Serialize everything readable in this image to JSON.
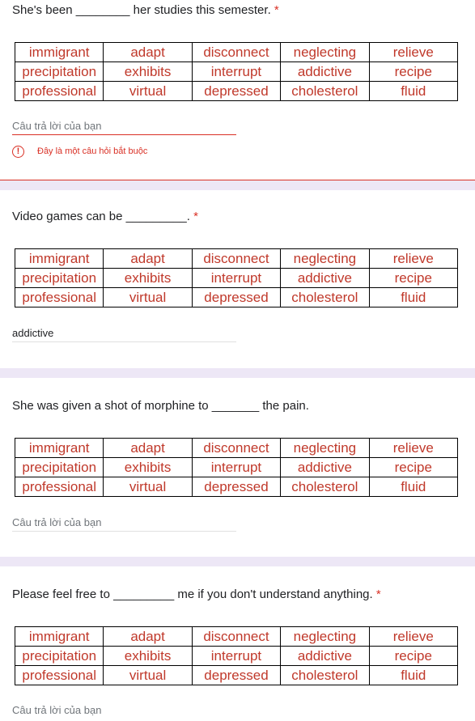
{
  "required_mark": "*",
  "word_table": [
    [
      "immigrant",
      "adapt",
      "disconnect",
      "neglecting",
      "relieve"
    ],
    [
      "precipitation",
      "exhibits",
      "interrupt",
      "addictive",
      "recipe"
    ],
    [
      "professional",
      "virtual",
      "depressed",
      "cholesterol",
      "fluid"
    ]
  ],
  "questions": [
    {
      "text": "She's been ________ her studies this semester.",
      "required": true,
      "answer_placeholder": "Câu trả lời của bạn",
      "answer_value": "",
      "error": "Đây là một câu hỏi bắt buộc"
    },
    {
      "text": "Video games can be _________.",
      "required": true,
      "answer_placeholder": "",
      "answer_value": "addictive",
      "error": ""
    },
    {
      "text": "She was given a shot of morphine to _______ the pain.",
      "required": false,
      "answer_placeholder": "Câu trả lời của bạn",
      "answer_value": "",
      "error": ""
    },
    {
      "text": "Please feel free to _________ me if you don't understand anything.",
      "required": true,
      "answer_placeholder": "Câu trả lời của bạn",
      "answer_value": "",
      "error": ""
    }
  ],
  "colors": {
    "table_text": "#c0392b",
    "error": "#d93025",
    "separator": "#ede7f6"
  }
}
